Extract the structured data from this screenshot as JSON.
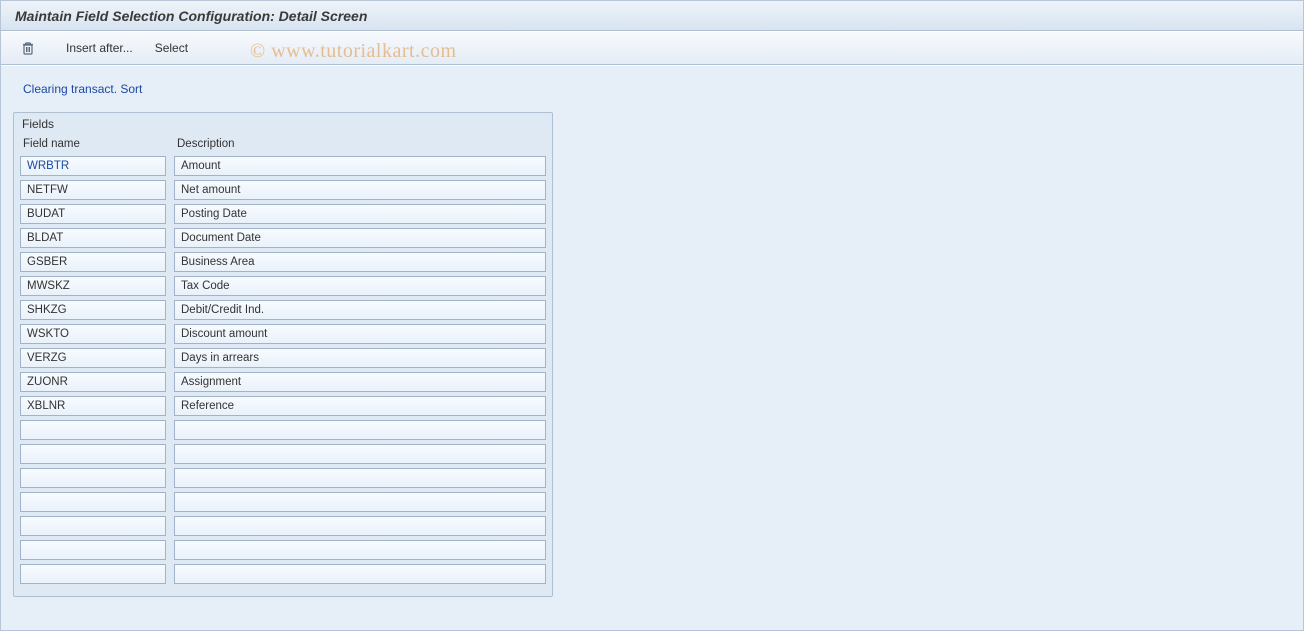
{
  "title": "Maintain Field Selection Configuration: Detail Screen",
  "toolbar": {
    "delete_tooltip": "Delete",
    "insert_after_label": "Insert after...",
    "select_label": "Select"
  },
  "breadcrumb": {
    "line1": "Clearing transact. Sort"
  },
  "groupbox": {
    "title": "Fields",
    "columns": {
      "field_name": "Field name",
      "description": "Description"
    },
    "rows": [
      {
        "field_name": "WRBTR",
        "description": "Amount"
      },
      {
        "field_name": "NETFW",
        "description": "Net amount"
      },
      {
        "field_name": "BUDAT",
        "description": "Posting Date"
      },
      {
        "field_name": "BLDAT",
        "description": "Document Date"
      },
      {
        "field_name": "GSBER",
        "description": "Business Area"
      },
      {
        "field_name": "MWSKZ",
        "description": "Tax Code"
      },
      {
        "field_name": "SHKZG",
        "description": "Debit/Credit Ind."
      },
      {
        "field_name": "WSKTO",
        "description": "Discount amount"
      },
      {
        "field_name": "VERZG",
        "description": "Days in arrears"
      },
      {
        "field_name": "ZUONR",
        "description": "Assignment"
      },
      {
        "field_name": "XBLNR",
        "description": "Reference"
      },
      {
        "field_name": "",
        "description": ""
      },
      {
        "field_name": "",
        "description": ""
      },
      {
        "field_name": "",
        "description": ""
      },
      {
        "field_name": "",
        "description": ""
      },
      {
        "field_name": "",
        "description": ""
      },
      {
        "field_name": "",
        "description": ""
      },
      {
        "field_name": "",
        "description": ""
      }
    ]
  },
  "watermark": "© www.tutorialkart.com"
}
